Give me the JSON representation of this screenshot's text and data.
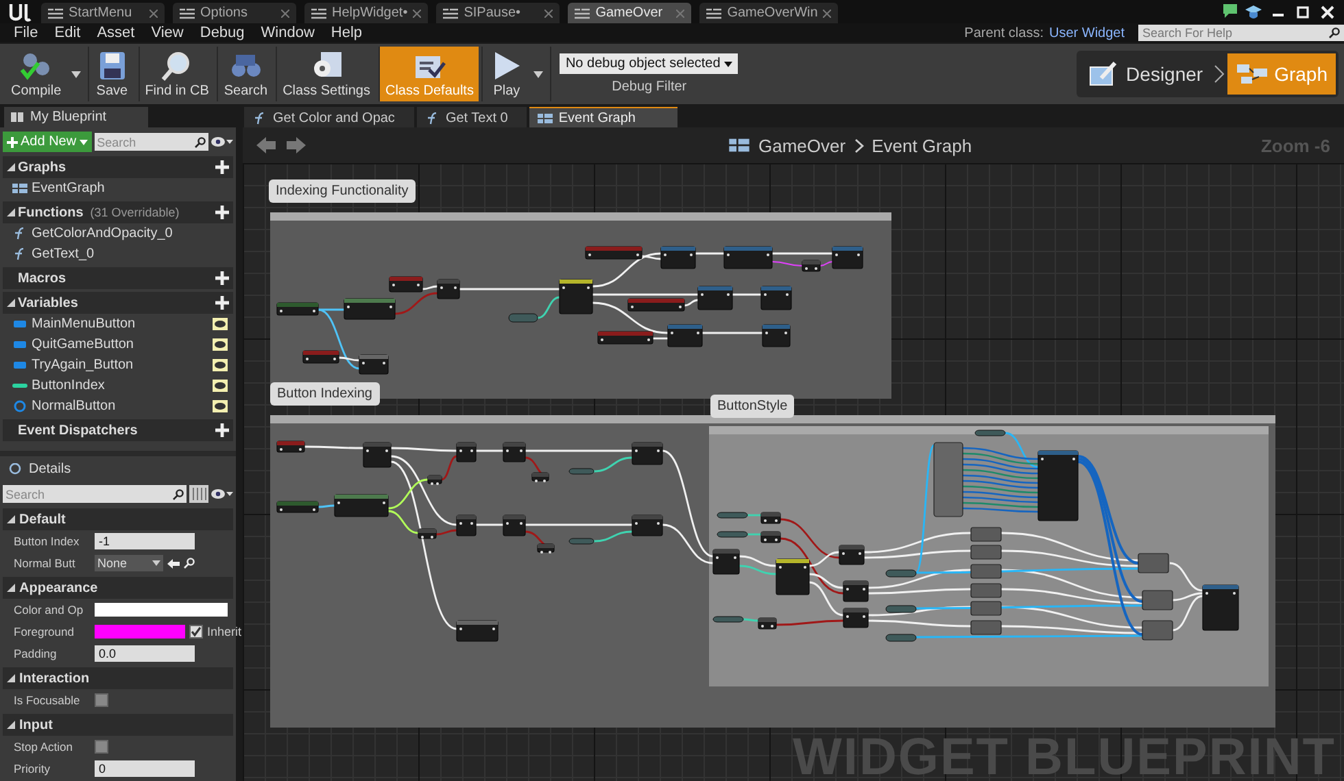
{
  "doc_tabs": [
    {
      "label": "StartMenu",
      "selected": false
    },
    {
      "label": "Options",
      "selected": false
    },
    {
      "label": "HelpWidget•",
      "selected": false
    },
    {
      "label": "SIPause•",
      "selected": false
    },
    {
      "label": "GameOver",
      "selected": true
    },
    {
      "label": "GameOverWin",
      "selected": false
    }
  ],
  "menu": [
    "File",
    "Edit",
    "Asset",
    "View",
    "Debug",
    "Window",
    "Help"
  ],
  "parent_class": {
    "label": "Parent class:",
    "value": "User Widget"
  },
  "help_search": {
    "placeholder": "Search For Help"
  },
  "toolbar": [
    {
      "kind": "compile",
      "label": "Compile",
      "dropdown": true,
      "selected": false
    },
    {
      "kind": "save",
      "label": "Save",
      "dropdown": false,
      "selected": false
    },
    {
      "kind": "find",
      "label": "Find in CB",
      "dropdown": false,
      "selected": false
    },
    {
      "kind": "search",
      "label": "Search",
      "dropdown": false,
      "selected": false
    },
    {
      "kind": "settings",
      "label": "Class Settings",
      "dropdown": false,
      "selected": false
    },
    {
      "kind": "defaults",
      "label": "Class Defaults",
      "dropdown": false,
      "selected": true
    },
    {
      "kind": "play",
      "label": "Play",
      "dropdown": true,
      "selected": false
    }
  ],
  "debug_filter": {
    "value": "No debug object selected",
    "label": "Debug Filter"
  },
  "modes": [
    {
      "kind": "designer",
      "label": "Designer",
      "selected": false
    },
    {
      "kind": "graph",
      "label": "Graph",
      "selected": true
    }
  ],
  "my_blueprint": {
    "tab": "My Blueprint",
    "add_button": "Add New",
    "search_placeholder": "Search",
    "sections": [
      {
        "title": "Graphs",
        "expanded": true,
        "items": [
          {
            "label": "EventGraph",
            "kind": "graph"
          }
        ]
      },
      {
        "title": "Functions",
        "note": "(31 Overridable)",
        "expanded": true,
        "items": [
          {
            "label": "GetColorAndOpacity_0",
            "kind": "function"
          },
          {
            "label": "GetText_0",
            "kind": "function"
          }
        ]
      },
      {
        "title": "Macros",
        "expanded": false
      },
      {
        "title": "Variables",
        "expanded": true,
        "items": [
          {
            "label": "MainMenuButton",
            "kind": "widget"
          },
          {
            "label": "QuitGameButton",
            "kind": "widget"
          },
          {
            "label": "TryAgain_Button",
            "kind": "widget"
          },
          {
            "label": "ButtonIndex",
            "kind": "integer"
          },
          {
            "label": "NormalButton",
            "kind": "struct"
          }
        ]
      },
      {
        "title": "Event Dispatchers",
        "expanded": false
      }
    ]
  },
  "editor_tabs": [
    {
      "kind": "function",
      "label": "Get Color and Opac",
      "selected": false
    },
    {
      "kind": "function",
      "label": "Get Text 0",
      "selected": false
    },
    {
      "kind": "graph",
      "label": "Event Graph",
      "selected": true
    }
  ],
  "details": {
    "tab": "Details",
    "search_placeholder": "Search",
    "categories": [
      {
        "title": "Default",
        "rows": [
          {
            "label": "Button Index",
            "kind": "number",
            "value": "-1"
          },
          {
            "label": "Normal Butt",
            "kind": "dropdown",
            "value": "None"
          }
        ]
      },
      {
        "title": "Appearance",
        "rows": [
          {
            "label": "Color and Op",
            "kind": "color",
            "color": "#ffffff"
          },
          {
            "label": "Foreground",
            "kind": "color",
            "color": "#ff00ff",
            "inherit": {
              "label": "Inherit",
              "checked": true
            }
          },
          {
            "label": "Padding",
            "kind": "text",
            "value": "0.0"
          }
        ]
      },
      {
        "title": "Interaction",
        "rows": [
          {
            "label": "Is Focusable",
            "kind": "checkbox",
            "checked": false
          }
        ]
      },
      {
        "title": "Input",
        "rows": [
          {
            "label": "Stop Action",
            "kind": "checkbox",
            "checked": false
          },
          {
            "label": "Priority",
            "kind": "number",
            "value": "0"
          }
        ]
      }
    ]
  },
  "graph": {
    "breadcrumb": [
      "GameOver",
      "Event Graph"
    ],
    "zoom": "Zoom -6",
    "comments": [
      {
        "title": "Indexing Functionality"
      },
      {
        "title": "Button Indexing"
      },
      {
        "title": "ButtonStyle"
      }
    ],
    "watermark": "WIDGET BLUEPRINT"
  }
}
